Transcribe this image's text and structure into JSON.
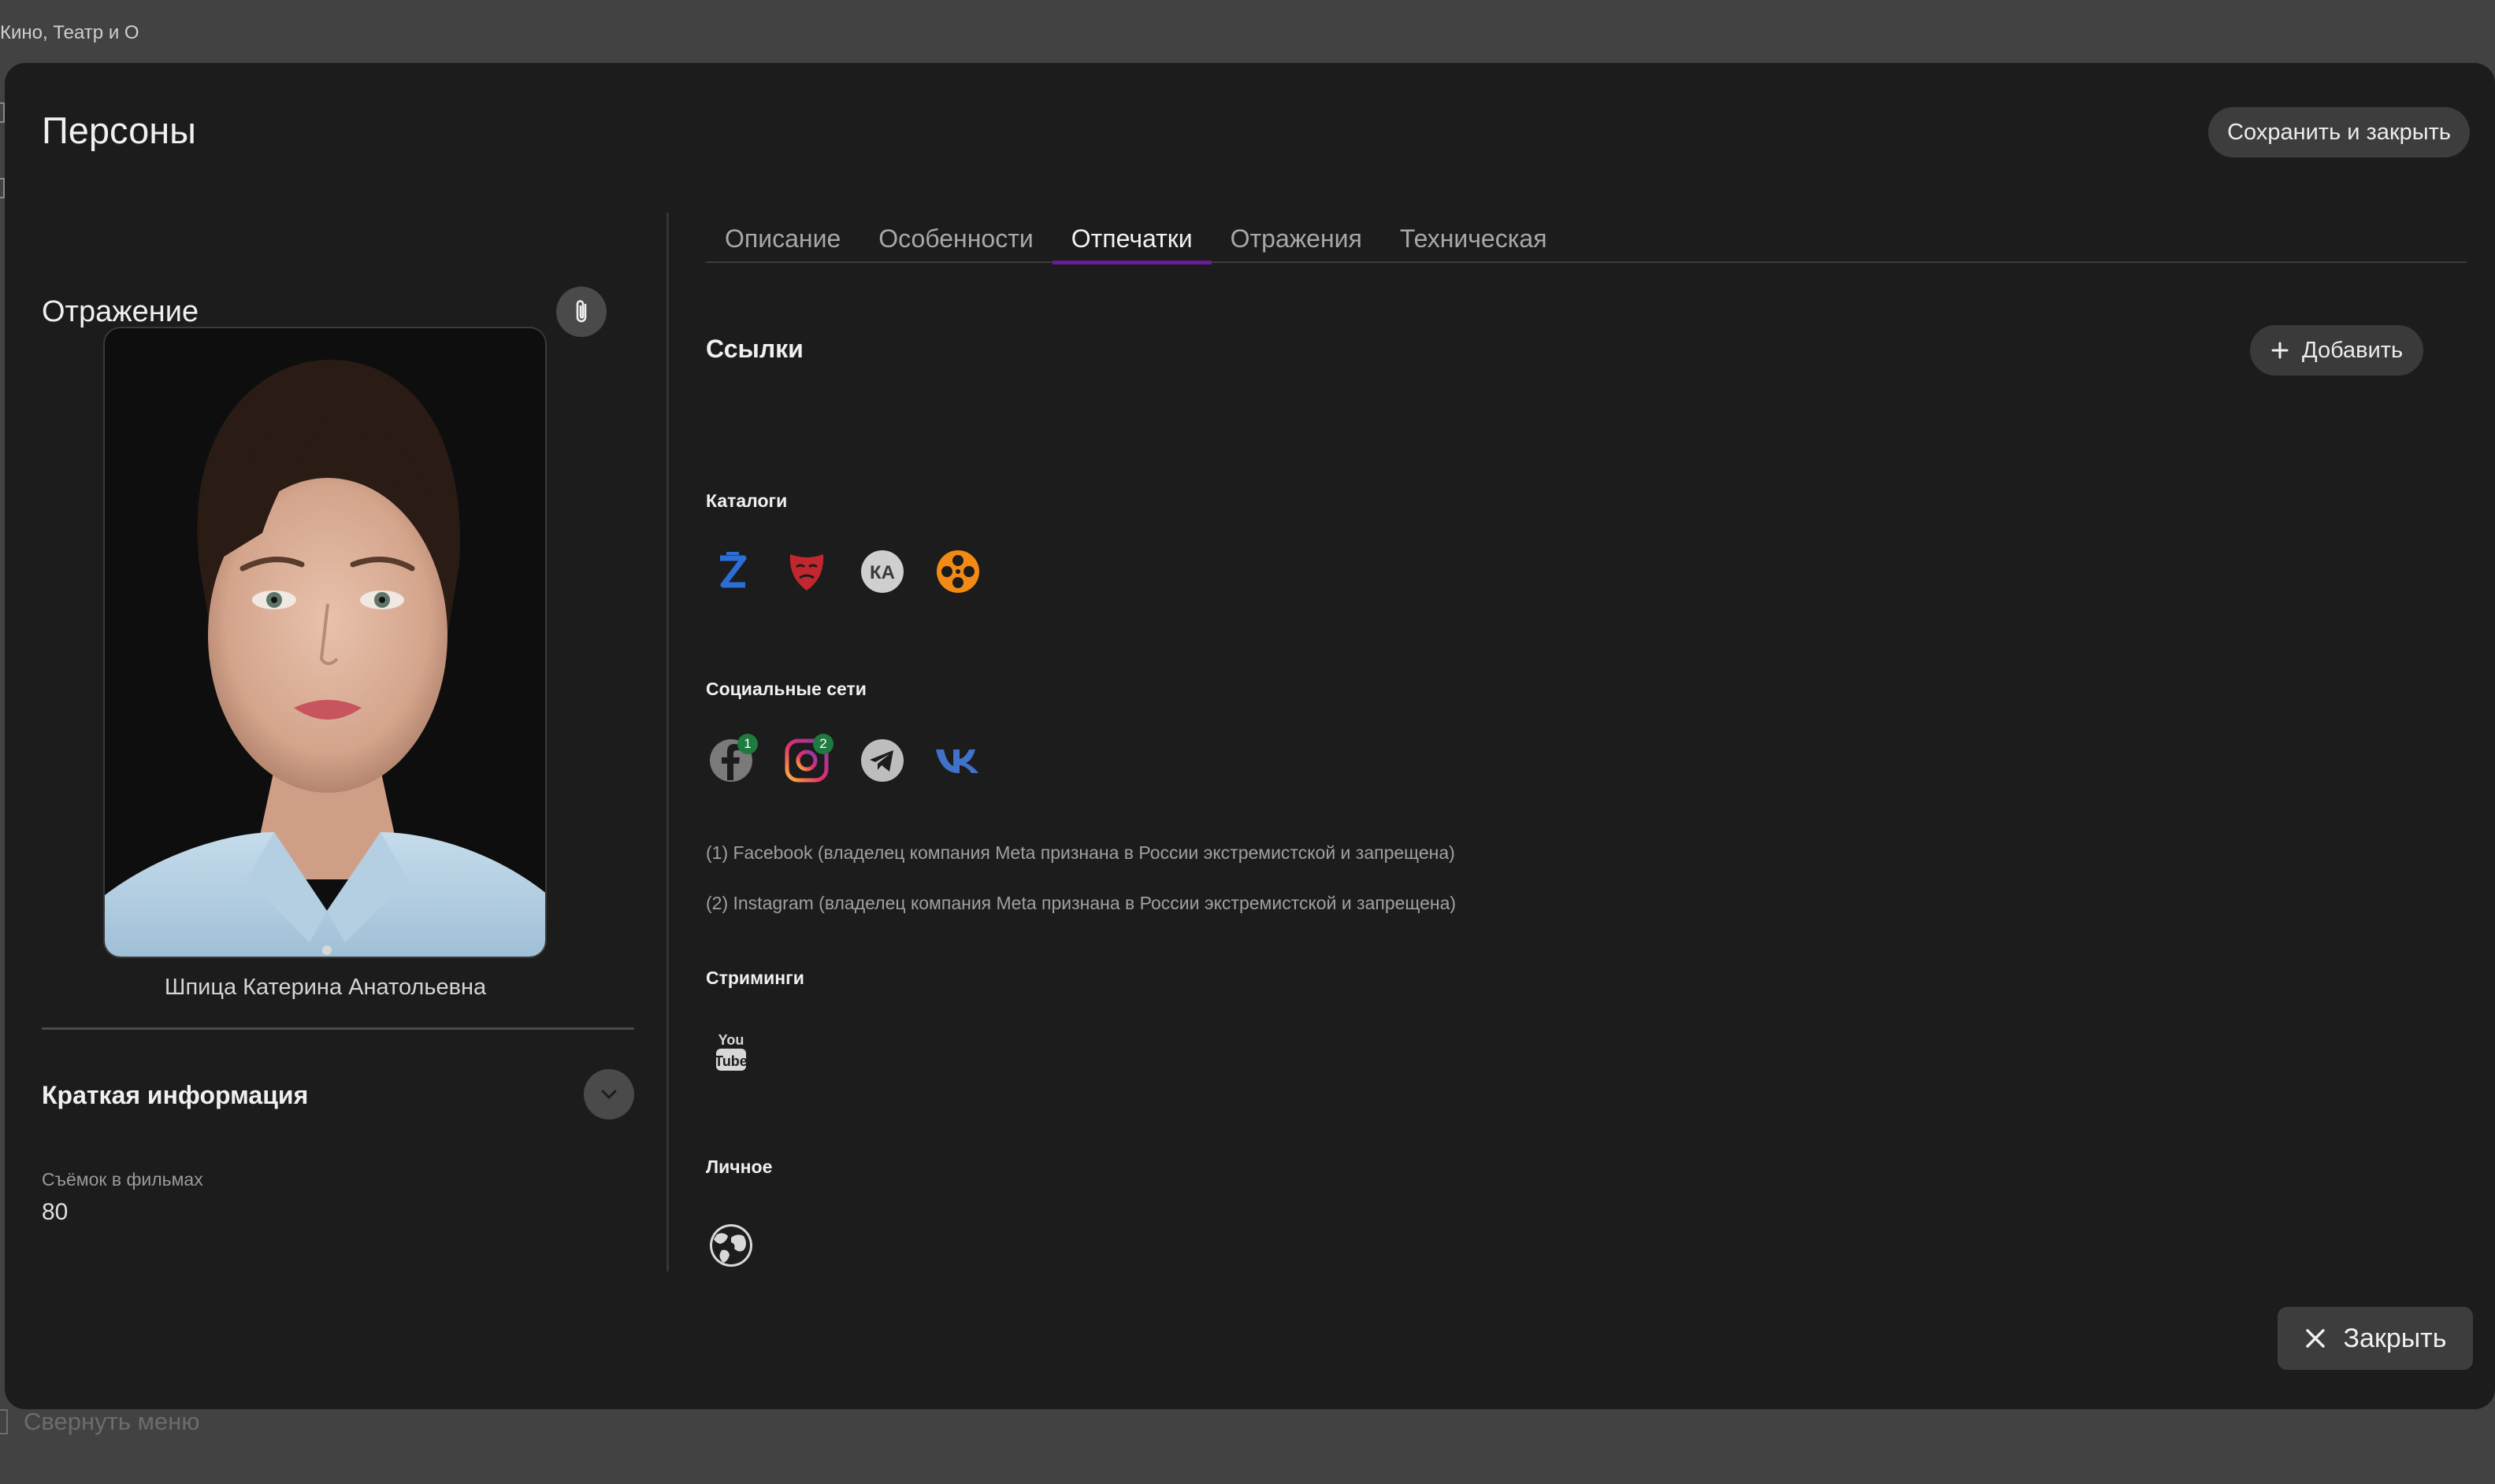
{
  "app": {
    "title": "Кино, Театр и О",
    "collapse_menu": "Свернуть меню"
  },
  "modal": {
    "title": "Персоны",
    "save_close": "Сохранить и закрыть",
    "close": "Закрыть"
  },
  "left": {
    "heading": "Отражение",
    "person_name": "Шпица Катерина Анатольевна",
    "brief_title": "Краткая информация",
    "stat_label": "Съёмок в фильмах",
    "stat_value": "80"
  },
  "tabs": [
    {
      "label": "Описание",
      "active": false
    },
    {
      "label": "Особенности",
      "active": false
    },
    {
      "label": "Отпечатки",
      "active": true
    },
    {
      "label": "Отражения",
      "active": false
    },
    {
      "label": "Техническая",
      "active": false
    }
  ],
  "links": {
    "title": "Ссылки",
    "add_label": "Добавить",
    "catalogs": {
      "title": "Каталоги",
      "icons": [
        "zoom-z-icon",
        "theatre-mask-icon",
        "kinoteatr-icon",
        "film-reel-icon"
      ]
    },
    "social": {
      "title": "Социальные сети",
      "icons": [
        "facebook-icon",
        "instagram-icon",
        "telegram-icon",
        "vk-icon"
      ],
      "badges": [
        "1",
        "2"
      ],
      "notes": [
        "(1) Facebook (владелец компания Meta признана в России экстремистской и запрещена)",
        "(2) Instagram (владелец компания Meta признана в России экстремистской и запрещена)"
      ]
    },
    "streaming": {
      "title": "Стриминги",
      "icons": [
        "youtube-icon"
      ]
    },
    "personal": {
      "title": "Личное",
      "icons": [
        "globe-icon"
      ]
    }
  },
  "colors": {
    "tab_indicator": "#6a1b9a",
    "badge": "#1e7a3e"
  }
}
